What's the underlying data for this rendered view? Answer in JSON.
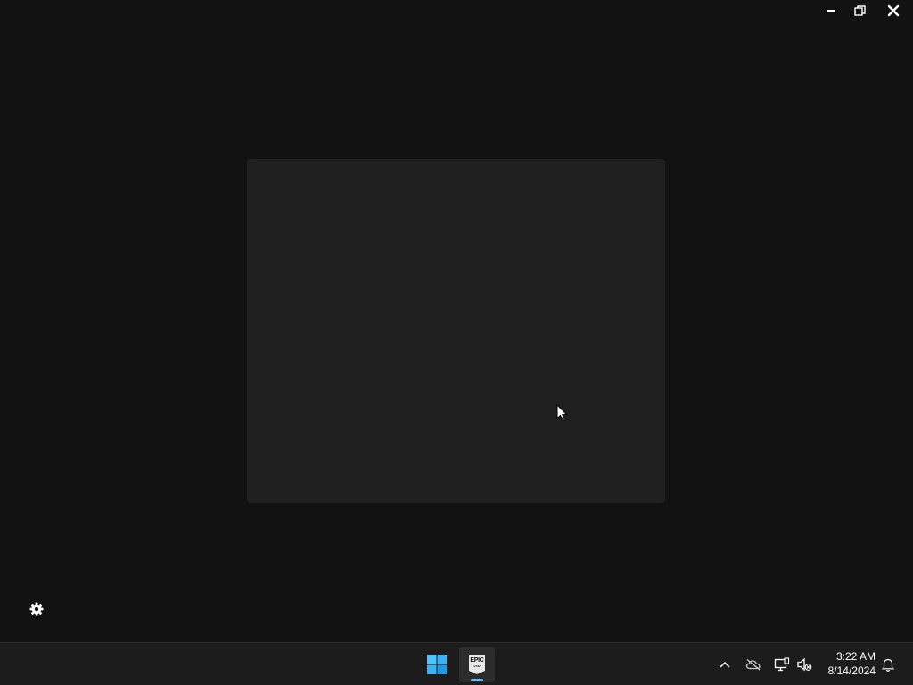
{
  "window": {
    "controls": {
      "minimize_icon": "minimize-icon",
      "restore_icon": "restore-icon",
      "close_icon": "close-icon"
    },
    "settings_icon": "gear-icon"
  },
  "taskbar": {
    "start_icon": "windows-logo-icon",
    "apps": [
      {
        "name": "Epic Games Launcher",
        "logo_text": "EPIC",
        "logo_subtext": "GAMES",
        "running": true
      }
    ],
    "tray": {
      "overflow_icon": "chevron-up-icon",
      "cloud_icon": "cloud-offline-icon",
      "network_icon": "network-icon",
      "volume_icon": "volume-muted-icon",
      "notification_icon": "bell-icon"
    },
    "clock": {
      "time": "3:22 AM",
      "date": "8/14/2024"
    }
  },
  "colors": {
    "background": "#121212",
    "panel": "#202020",
    "taskbar": "#1c1c1c",
    "accent": "#6cb8f0"
  }
}
